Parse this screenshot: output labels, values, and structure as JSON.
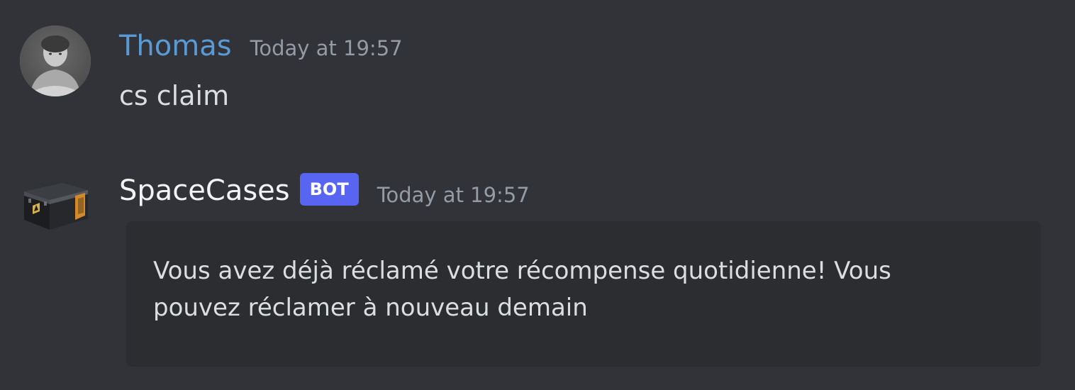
{
  "messages": [
    {
      "author": "Thomas",
      "author_color": "#5b9bd5",
      "timestamp": "Today at 19:57",
      "content": "cs claim",
      "avatar": "user-photo-avatar"
    },
    {
      "author": "SpaceCases",
      "author_color": "#f2f3f5",
      "bot_tag": "BOT",
      "bot_tag_color": "#5865f2",
      "timestamp": "Today at 19:57",
      "avatar": "weapon-case-icon",
      "embed": {
        "description": "Vous avez déjà réclamé votre récompense quotidienne! Vous pouvez réclamer à nouveau demain"
      }
    }
  ],
  "colors": {
    "background": "#313338",
    "embed_background": "#2b2d31",
    "timestamp": "#949ba4",
    "text": "#dbdee1"
  }
}
